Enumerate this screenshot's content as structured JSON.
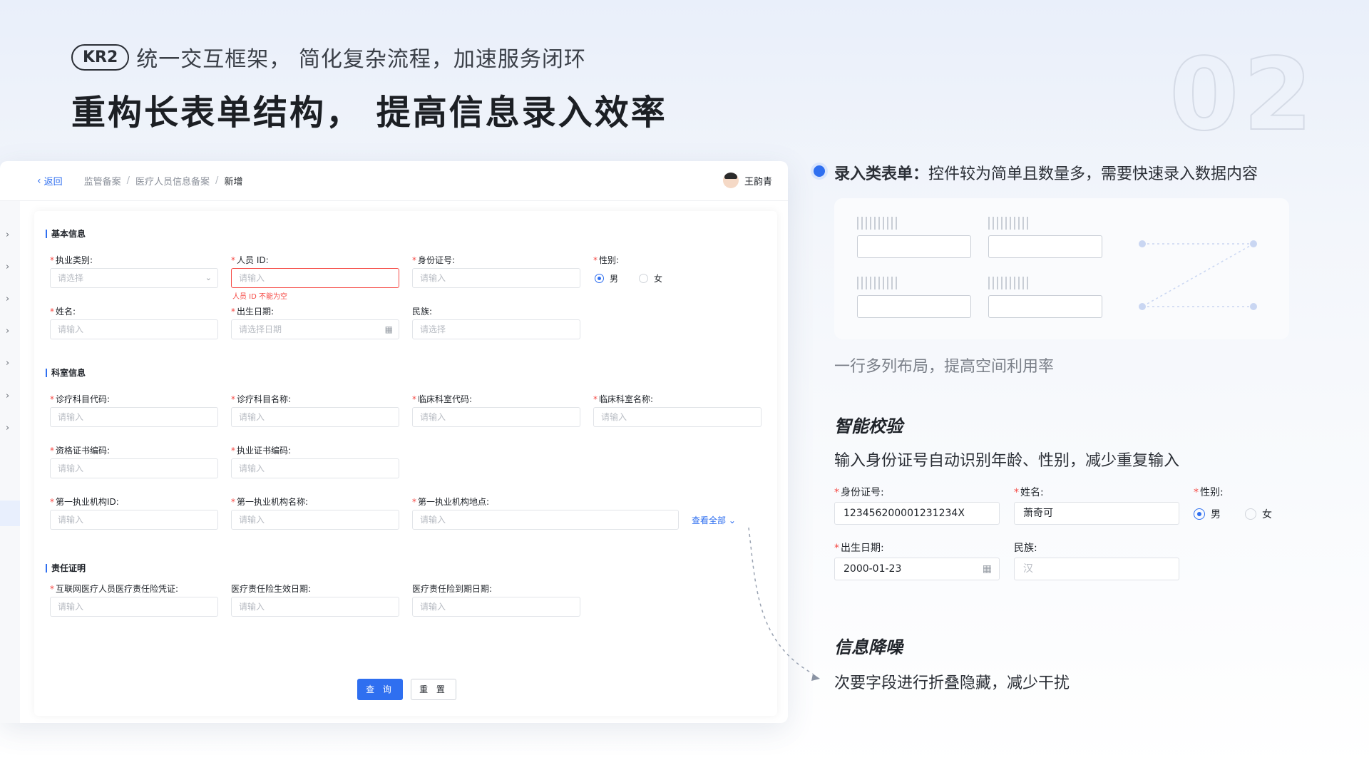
{
  "header": {
    "badge": "KR2",
    "subtitle": "统一交互框架， 简化复杂流程，加速服务闭环",
    "title": "重构长表单结构， 提高信息录入效率",
    "big_number": "02"
  },
  "app": {
    "back_label": "返回",
    "breadcrumb": [
      "监管备案",
      "医疗人员信息备案",
      "新增"
    ],
    "user_name": "王韵青",
    "sections": {
      "basic": "基本信息",
      "dept": "科室信息",
      "liability": "责任证明"
    },
    "fields": {
      "practice_type": {
        "label": "执业类别:",
        "placeholder": "请选择"
      },
      "person_id": {
        "label": "人员 ID:",
        "placeholder": "请输入",
        "error": "人员 ID 不能为空"
      },
      "id_card": {
        "label": "身份证号:",
        "placeholder": "请输入"
      },
      "gender": {
        "label": "性别:",
        "options": [
          "男",
          "女"
        ],
        "selected": "男"
      },
      "name": {
        "label": "姓名:",
        "placeholder": "请输入"
      },
      "birth": {
        "label": "出生日期:",
        "placeholder": "请选择日期"
      },
      "ethnic": {
        "label": "民族:",
        "placeholder": "请选择"
      },
      "subject_code": {
        "label": "诊疗科目代码:",
        "placeholder": "请输入"
      },
      "subject_name": {
        "label": "诊疗科目名称:",
        "placeholder": "请输入"
      },
      "dept_code": {
        "label": "临床科室代码:",
        "placeholder": "请输入"
      },
      "dept_name": {
        "label": "临床科室名称:",
        "placeholder": "请输入"
      },
      "qual_cert": {
        "label": "资格证书编码:",
        "placeholder": "请输入"
      },
      "practice_cert": {
        "label": "执业证书编码:",
        "placeholder": "请输入"
      },
      "org_id": {
        "label": "第一执业机构ID:",
        "placeholder": "请输入"
      },
      "org_name": {
        "label": "第一执业机构名称:",
        "placeholder": "请输入"
      },
      "org_loc": {
        "label": "第一执业机构地点:",
        "placeholder": "请输入"
      },
      "insurance_cert": {
        "label": "互联网医疗人员医疗责任险凭证:",
        "placeholder": "请输入"
      },
      "insurance_start": {
        "label": "医疗责任险生效日期:",
        "placeholder": "请输入"
      },
      "insurance_end": {
        "label": "医疗责任险到期日期:",
        "placeholder": "请输入"
      }
    },
    "view_all": "查看全部",
    "query_btn": "查 询",
    "reset_btn": "重 置"
  },
  "panel": {
    "headline_bold": "录入类表单：",
    "headline_rest": "控件较为简单且数量多，需要快速录入数据内容",
    "layout_note": "一行多列布局，提高空间利用率",
    "smart_title": "智能校验",
    "smart_desc": "输入身份证号自动识别年龄、性别，减少重复输入",
    "demo": {
      "id_label": "身份证号:",
      "id_value": "123456200001231234X",
      "name_label": "姓名:",
      "name_value": "萧奇可",
      "gender_label": "性别:",
      "gender_options": [
        "男",
        "女"
      ],
      "gender_selected": "男",
      "birth_label": "出生日期:",
      "birth_value": "2000-01-23",
      "ethnic_label": "民族:",
      "ethnic_placeholder": "汉"
    },
    "noise_title": "信息降噪",
    "noise_desc": "次要字段进行折叠隐藏，减少干扰"
  },
  "colors": {
    "accent": "#2f6ff0",
    "error": "#f54a45",
    "background": "#eef3fb"
  }
}
